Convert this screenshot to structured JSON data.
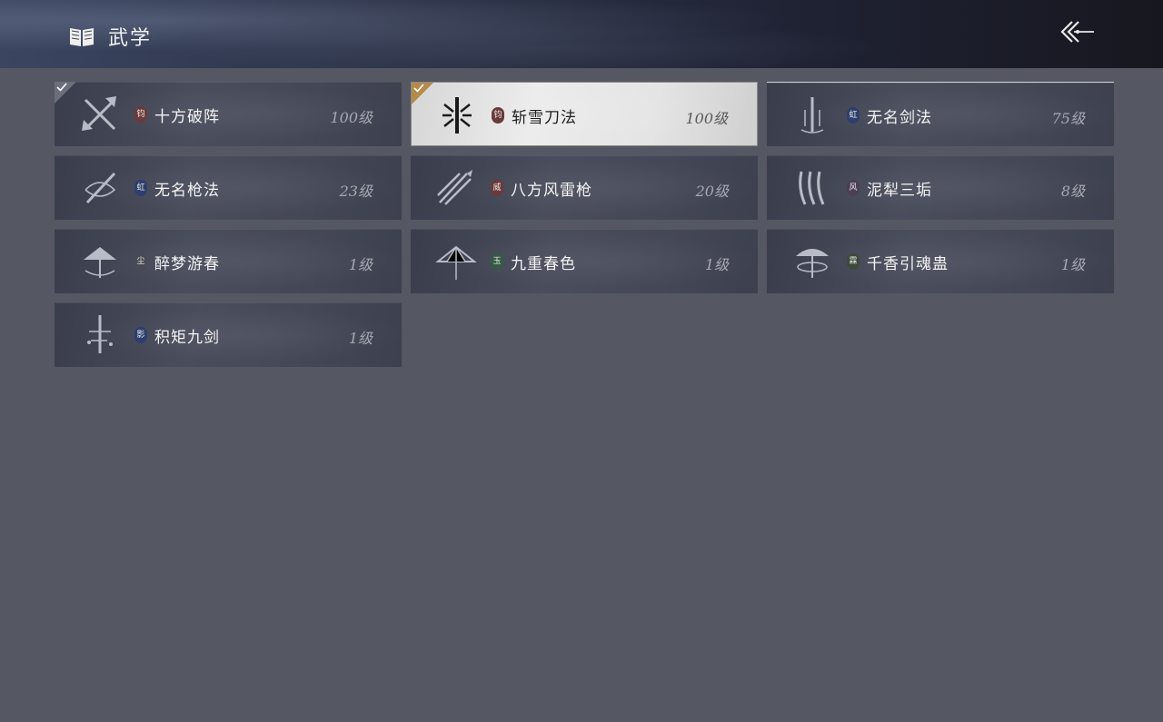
{
  "header": {
    "title": "武学",
    "icon": "book-icon",
    "back_icon": "back-arrow-icon"
  },
  "colors": {
    "background": "#555762",
    "card": "#454857",
    "card_selected": "#e6e6e6",
    "check_gold": "#b58b4a",
    "check_grey": "#6b6f7c"
  },
  "skills": [
    {
      "name": "十方破阵",
      "level": "100级",
      "badge": "钧",
      "badge_color": "#6b3a3a",
      "icon": "crossed-blades-icon",
      "checked": true,
      "selected": false
    },
    {
      "name": "斩雪刀法",
      "level": "100级",
      "badge": "钧",
      "badge_color": "#6b3a3a",
      "icon": "snow-blade-icon",
      "checked": true,
      "selected": true
    },
    {
      "name": "无名剑法",
      "level": "75级",
      "badge": "虹",
      "badge_color": "#2e3f6e",
      "icon": "sword-icon",
      "checked": false,
      "selected": false
    },
    {
      "name": "无名枪法",
      "level": "23级",
      "badge": "虹",
      "badge_color": "#2e3f6e",
      "icon": "spear-swirl-icon",
      "checked": false,
      "selected": false
    },
    {
      "name": "八方风雷枪",
      "level": "20级",
      "badge": "威",
      "badge_color": "#6b3a3a",
      "icon": "thunder-spear-icon",
      "checked": false,
      "selected": false
    },
    {
      "name": "泥犁三垢",
      "level": "8级",
      "badge": "风",
      "badge_color": "#4a3f55",
      "icon": "claw-slash-icon",
      "checked": false,
      "selected": false
    },
    {
      "name": "醉梦游春",
      "level": "1级",
      "badge": "尘",
      "badge_color": "#4a4a55",
      "icon": "umbrella-swirl-icon",
      "checked": false,
      "selected": false
    },
    {
      "name": "九重春色",
      "level": "1级",
      "badge": "玉",
      "badge_color": "#355a45",
      "icon": "umbrella-icon",
      "checked": false,
      "selected": false
    },
    {
      "name": "千香引魂蛊",
      "level": "1级",
      "badge": "霖",
      "badge_color": "#3d4a3a",
      "icon": "parasol-ring-icon",
      "checked": false,
      "selected": false
    },
    {
      "name": "积矩九剑",
      "level": "1级",
      "badge": "影",
      "badge_color": "#2e3f6e",
      "icon": "flying-swords-icon",
      "checked": false,
      "selected": false
    }
  ]
}
